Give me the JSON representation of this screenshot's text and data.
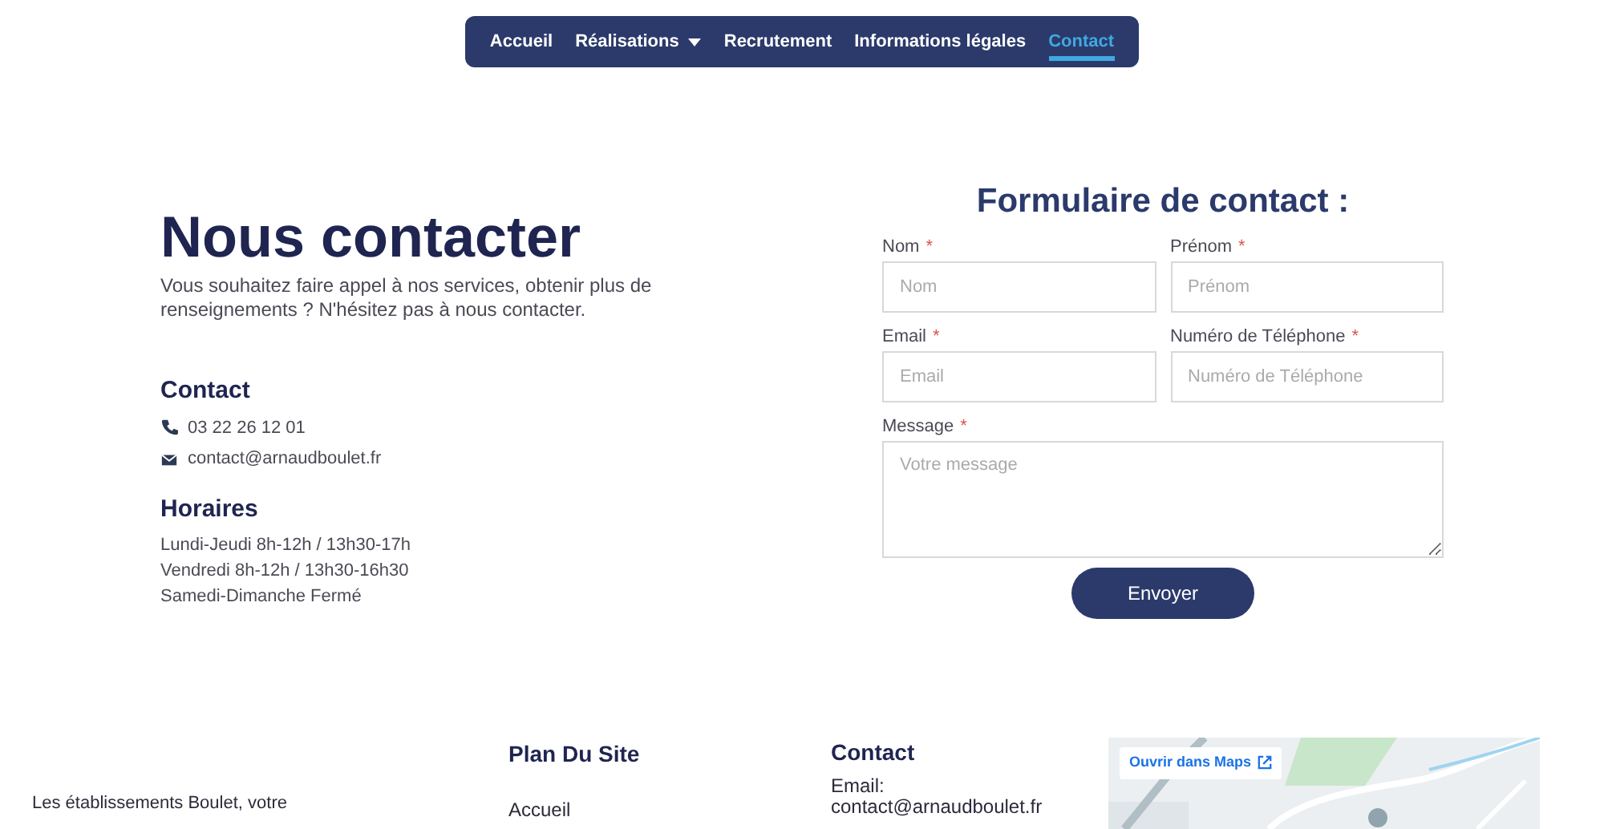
{
  "nav": {
    "items": [
      {
        "label": "Accueil",
        "selected": false,
        "dropdown": false
      },
      {
        "label": "Réalisations",
        "selected": false,
        "dropdown": true
      },
      {
        "label": "Recrutement",
        "selected": false,
        "dropdown": false
      },
      {
        "label": "Informations légales",
        "selected": false,
        "dropdown": false
      },
      {
        "label": "Contact",
        "selected": true,
        "dropdown": false
      }
    ]
  },
  "intro": {
    "title": "Nous contacter",
    "text": "Vous souhaitez faire appel à nos services, obtenir plus de renseignements ? N'hésitez pas à nous contacter."
  },
  "contact": {
    "title": "Contact",
    "items": [
      {
        "kind": "phone",
        "text": "03 22 26 12 01"
      },
      {
        "kind": "email",
        "text": "contact@arnaudboulet.fr"
      }
    ]
  },
  "hours": {
    "title": "Horaires",
    "lines": [
      "Lundi-Jeudi 8h-12h / 13h30-17h",
      "Vendredi 8h-12h / 13h30-16h30",
      "Samedi-Dimanche Fermé"
    ]
  },
  "form": {
    "title": "Formulaire de contact :",
    "fields": [
      {
        "kind": "input",
        "label": "Nom",
        "required": "*",
        "placeholder": "Nom"
      },
      {
        "kind": "input",
        "label": "Prénom",
        "required": "*",
        "placeholder": "Prénom"
      },
      {
        "kind": "input",
        "label": "Email",
        "required": "*",
        "placeholder": "Email"
      },
      {
        "kind": "input",
        "label": "Numéro de Téléphone",
        "required": "*",
        "placeholder": "Numéro de Téléphone"
      },
      {
        "kind": "textarea",
        "label": "Message",
        "required": "*",
        "placeholder": "Votre message"
      }
    ],
    "submit": "Envoyer"
  },
  "footer": {
    "about": "Les établissements Boulet, votre",
    "sitemap": {
      "title": "Plan Du Site",
      "links": [
        "Accueil"
      ]
    },
    "contact": {
      "title": "Contact",
      "email_label": "Email:",
      "email": "contact@arnaudboulet.fr"
    },
    "map": {
      "kind": "picture",
      "open_link": "Ouvrir dans Maps"
    }
  }
}
